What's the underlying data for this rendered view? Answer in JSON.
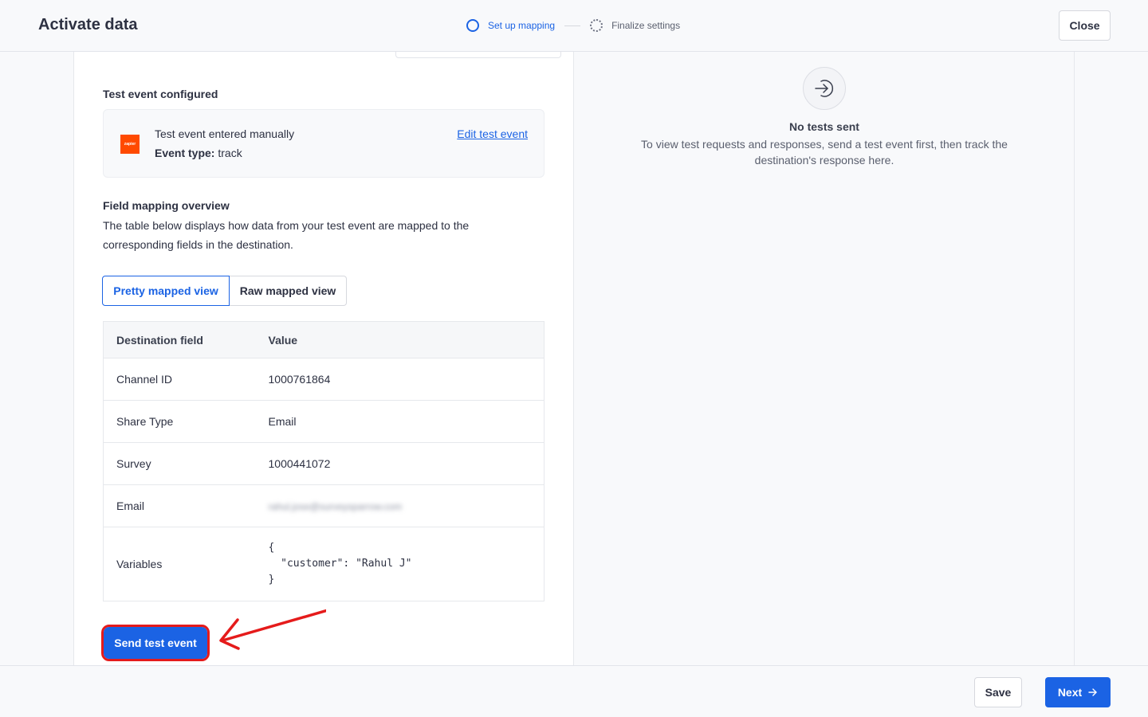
{
  "header": {
    "title": "Activate data",
    "steps": [
      {
        "label": "Set up mapping",
        "state": "active"
      },
      {
        "label": "Finalize settings",
        "state": "pending"
      }
    ],
    "close_label": "Close"
  },
  "test_event": {
    "section_title": "Test event configured",
    "logo_text": "zapier",
    "description": "Test event entered manually",
    "event_type_label": "Event type:",
    "event_type_value": "track",
    "edit_link": "Edit test event"
  },
  "field_mapping": {
    "title": "Field mapping overview",
    "description": "The table below displays how data from your test event are mapped to the corresponding fields in the destination.",
    "views": [
      "Pretty mapped view",
      "Raw mapped view"
    ],
    "active_view": "Pretty mapped view",
    "columns": [
      "Destination field",
      "Value"
    ],
    "rows": [
      {
        "field": "Channel ID",
        "value": "1000761864"
      },
      {
        "field": "Share Type",
        "value": "Email"
      },
      {
        "field": "Survey",
        "value": "1000441072"
      },
      {
        "field": "Email",
        "value": "rahul.jose@surveysparrow.com"
      },
      {
        "field": "Variables",
        "value": "{\n  \"customer\": \"Rahul J\"\n}"
      }
    ]
  },
  "send_button": "Send test event",
  "test_results": {
    "title": "No tests sent",
    "text": "To view test requests and responses, send a test event first, then track the destination's response here."
  },
  "footer": {
    "save_label": "Save",
    "next_label": "Next"
  },
  "colors": {
    "accent": "#1b63e4",
    "highlight": "#e51b1b",
    "zapier": "#ff4a00"
  }
}
